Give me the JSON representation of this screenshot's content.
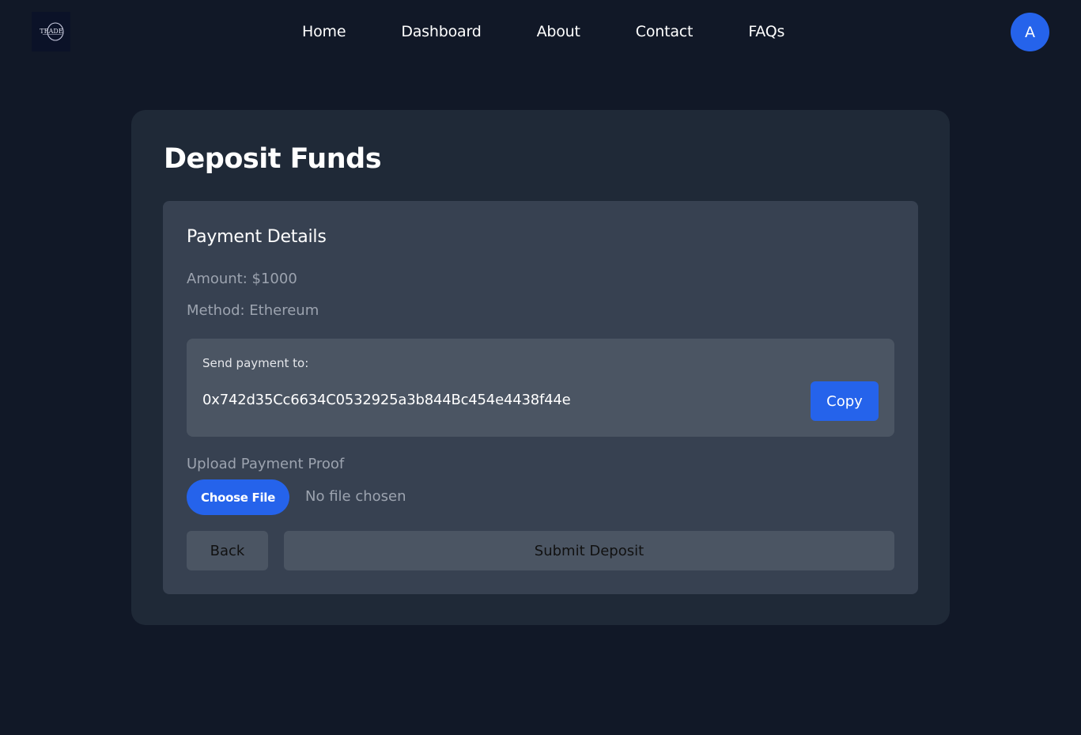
{
  "nav": {
    "logo_text": "TRADE",
    "links": [
      {
        "label": "Home"
      },
      {
        "label": "Dashboard"
      },
      {
        "label": "About"
      },
      {
        "label": "Contact"
      },
      {
        "label": "FAQs"
      }
    ],
    "avatar_initial": "A"
  },
  "main": {
    "title": "Deposit Funds",
    "panel": {
      "title": "Payment Details",
      "amount": "Amount: $1000",
      "method": "Method: Ethereum",
      "send_label": "Send payment to:",
      "address": "0x742d35Cc6634C0532925a3b844Bc454e4438f44e",
      "copy_label": "Copy",
      "upload_label": "Upload Payment Proof",
      "choose_file_label": "Choose File",
      "file_status": "No file chosen",
      "back_label": "Back",
      "submit_label": "Submit Deposit"
    }
  },
  "colors": {
    "background": "#111827",
    "card": "#1f2937",
    "panel": "#374151",
    "address_box": "#4b5563",
    "accent": "#2563eb",
    "muted_text": "#9ca3af"
  }
}
